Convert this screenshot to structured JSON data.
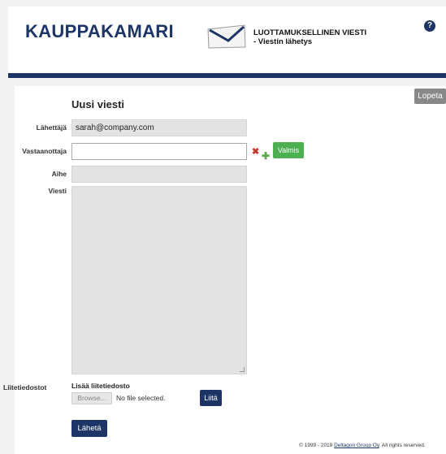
{
  "header": {
    "brand": "KAUPPAKAMARI",
    "title_line1": "LUOTTAMUKSELLINEN VIESTI",
    "title_line2": "- Viestin lähetys",
    "help_glyph": "?"
  },
  "page": {
    "title": "Uusi viesti",
    "close_label": "Lopeta"
  },
  "form": {
    "sender_label": "Lähettäjä",
    "sender_value": "sarah@company.com",
    "recipient_label": "Vastaanottaja",
    "recipient_value": "",
    "done_label": "Valmis",
    "subject_label": "Aihe",
    "subject_value": "",
    "message_label": "Viesti",
    "message_value": ""
  },
  "attachments": {
    "label": "Liitetiedostot",
    "title": "Lisää liitetiedosto",
    "browse_label": "Browse...",
    "no_file_text": "No file selected.",
    "attach_label": "Liitä"
  },
  "actions": {
    "send_label": "Lähetä"
  },
  "footer": {
    "prefix": "© 1999 - 2019 ",
    "company": "Deltagon Group Oy",
    "suffix": ". All rights reserved."
  },
  "colors": {
    "brand_navy": "#1d3566",
    "done_green": "#4caf50",
    "remove_red": "#c0392b",
    "close_gray": "#888888"
  },
  "icons": {
    "envelope": "envelope-icon",
    "help": "help-icon",
    "remove": "remove-recipient-icon",
    "add": "add-recipient-icon"
  }
}
